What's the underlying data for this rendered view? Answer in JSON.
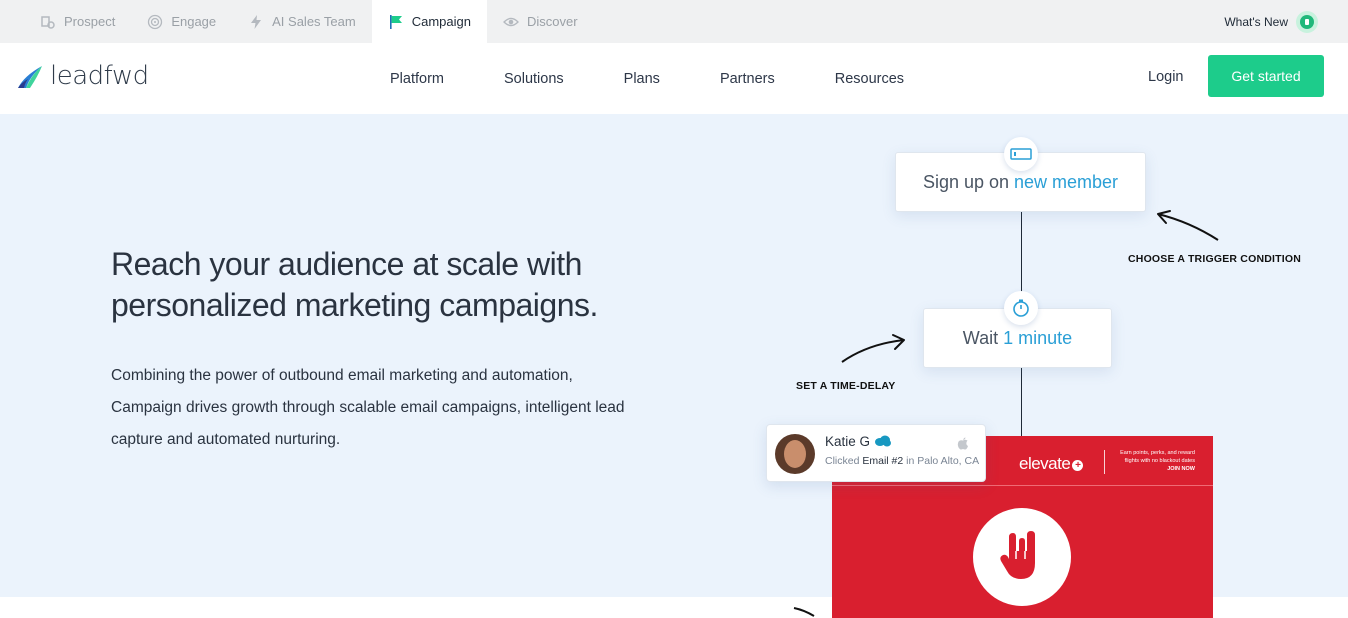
{
  "topbar": {
    "tabs": [
      {
        "label": "Prospect",
        "icon": "prospect-icon"
      },
      {
        "label": "Engage",
        "icon": "engage-icon"
      },
      {
        "label": "AI Sales Team",
        "icon": "lightning-icon"
      },
      {
        "label": "Campaign",
        "icon": "flag-icon",
        "active": true
      },
      {
        "label": "Discover",
        "icon": "eye-icon"
      }
    ],
    "whats_new": "What's New"
  },
  "nav": {
    "logo_text": "leadfwd",
    "links": [
      "Platform",
      "Solutions",
      "Plans",
      "Partners",
      "Resources"
    ],
    "login": "Login",
    "cta": "Get started"
  },
  "hero": {
    "headline": "Reach your audience at scale with personalized marketing campaigns.",
    "description": "Combining the power of outbound email marketing and automation, Campaign drives growth through scalable email campaigns, intelligent lead capture and automated nurturing."
  },
  "workflow": {
    "trigger": {
      "prefix": "Sign up on ",
      "highlight": "new member"
    },
    "trigger_annotation": "CHOOSE A TRIGGER CONDITION",
    "wait": {
      "prefix": "Wait ",
      "highlight": "1 minute"
    },
    "wait_annotation": "SET A TIME-DELAY"
  },
  "contact_card": {
    "name": "Katie G",
    "activity_prefix": "Clicked ",
    "activity_email": "Email #2",
    "activity_suffix": " in Palo Alto, CA"
  },
  "email_preview": {
    "brand": "elevate",
    "tagline": "Earn points, perks, and reward flights with no blackout dates",
    "join": "JOIN NOW"
  },
  "colors": {
    "accent_green": "#1dcc8b",
    "hero_bg": "#ebf3fc",
    "highlight_blue": "#2a9fd6",
    "email_red": "#d91f2f"
  }
}
